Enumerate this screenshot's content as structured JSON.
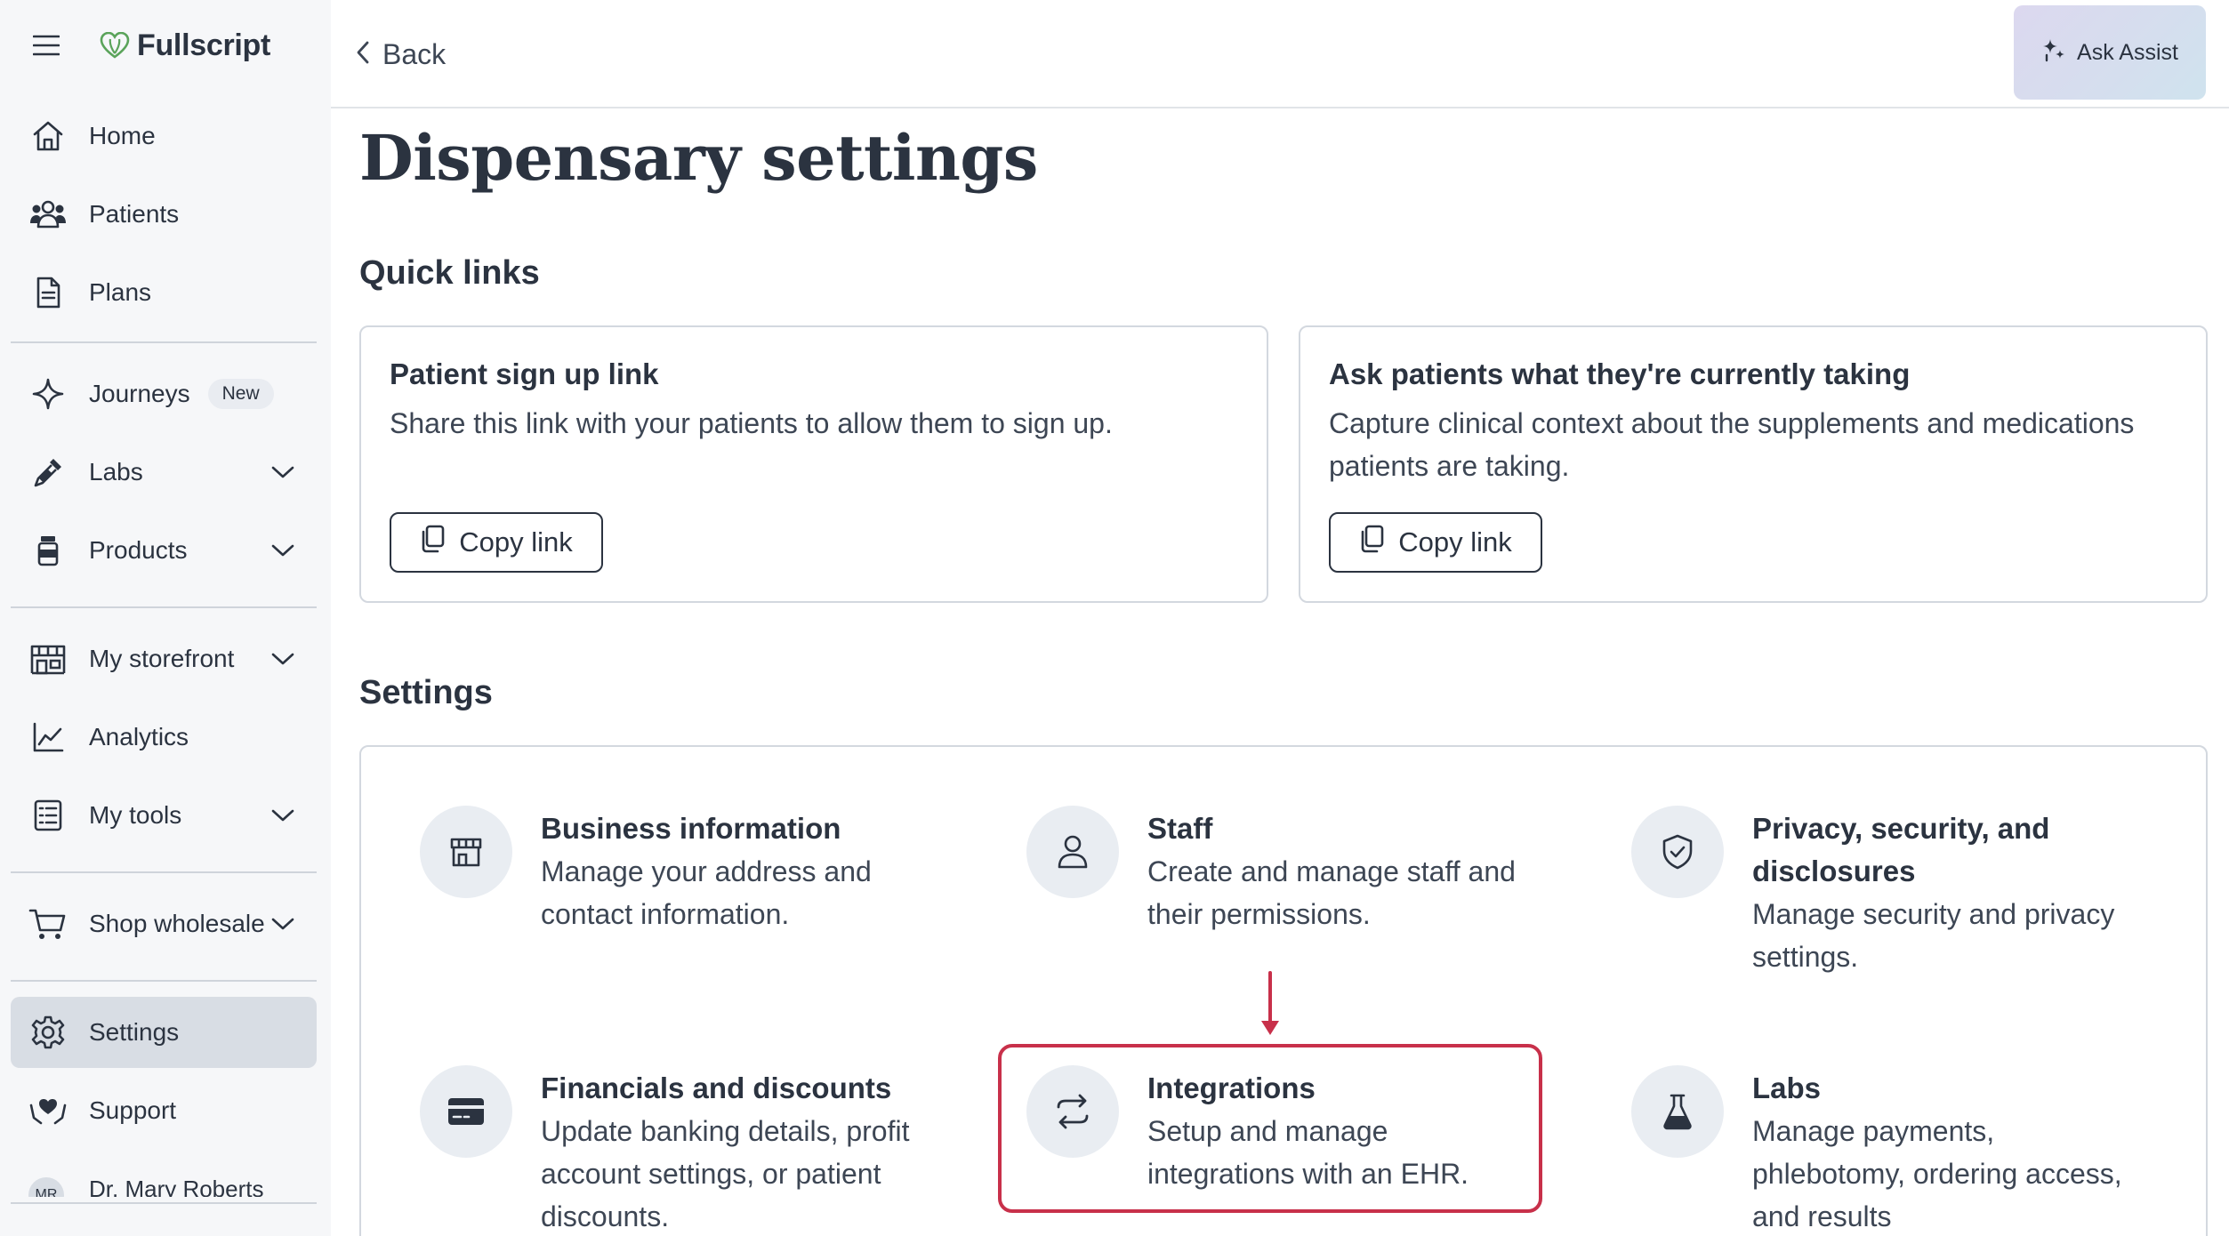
{
  "brand": {
    "name": "Fullscript"
  },
  "sidebar": {
    "items": [
      {
        "label": "Home"
      },
      {
        "label": "Patients"
      },
      {
        "label": "Plans"
      },
      {
        "label": "Journeys",
        "badge": "New"
      },
      {
        "label": "Labs"
      },
      {
        "label": "Products"
      },
      {
        "label": "My storefront"
      },
      {
        "label": "Analytics"
      },
      {
        "label": "My tools"
      },
      {
        "label": "Shop wholesale"
      },
      {
        "label": "Settings",
        "active": true
      },
      {
        "label": "Support"
      }
    ],
    "user": {
      "initials": "MR",
      "name": "Dr. Mary Roberts"
    }
  },
  "topbar": {
    "back_label": "Back",
    "ask_assist_label": "Ask Assist"
  },
  "page": {
    "title": "Dispensary settings"
  },
  "quick_links": {
    "heading": "Quick links",
    "cards": [
      {
        "title": "Patient sign up link",
        "description": "Share this link with your patients to allow them to sign up.",
        "button": "Copy link"
      },
      {
        "title": "Ask patients what they're currently taking",
        "description": "Capture clinical context about the supplements and medications patients are taking.",
        "button": "Copy link"
      }
    ]
  },
  "settings": {
    "heading": "Settings",
    "items": [
      {
        "title": "Business information",
        "description": "Manage your address and contact information."
      },
      {
        "title": "Staff",
        "description": "Create and manage staff and their permissions."
      },
      {
        "title": "Privacy, security, and disclosures",
        "description": "Manage security and privacy settings."
      },
      {
        "title": "Financials and discounts",
        "description": "Update banking details, profit account settings, or patient discounts."
      },
      {
        "title": "Integrations",
        "description": "Setup and manage integrations with an EHR."
      },
      {
        "title": "Labs",
        "description": "Manage payments, phlebotomy, ordering access, and results"
      }
    ]
  },
  "colors": {
    "highlight": "#c8304a",
    "active_nav": "#d8dde4",
    "brand_leaf": "#5aa35a"
  }
}
